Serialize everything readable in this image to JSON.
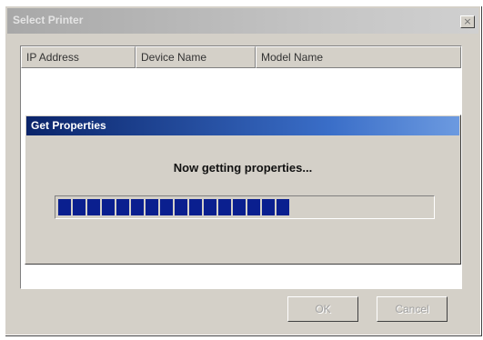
{
  "window": {
    "title": "Select Printer",
    "close_glyph": "×"
  },
  "list": {
    "columns": [
      "IP Address",
      "Device Name",
      "Model Name"
    ]
  },
  "dialog": {
    "title": "Get Properties",
    "message": "Now getting properties...",
    "progress_fraction": 0.64,
    "progress_color": "#0a1f8f"
  },
  "buttons": {
    "ok_label": "OK",
    "cancel_label": "Cancel"
  }
}
